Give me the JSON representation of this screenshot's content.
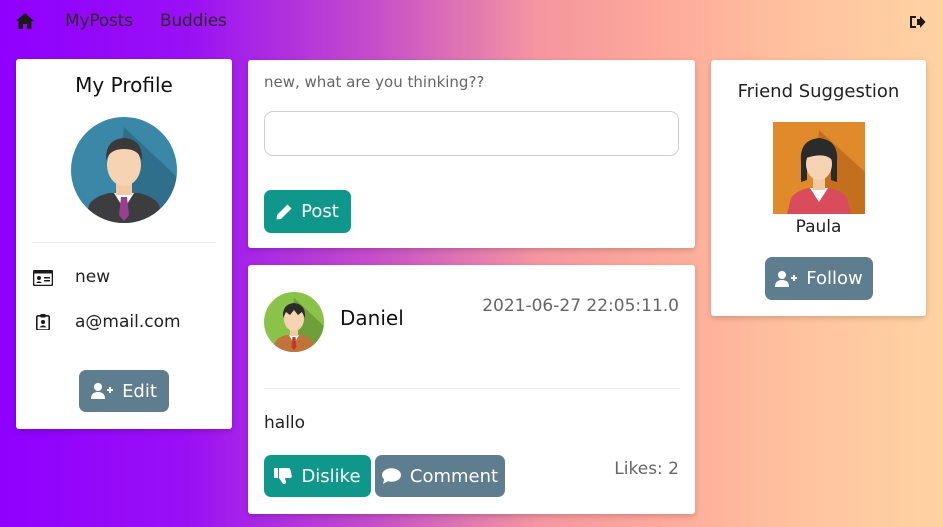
{
  "nav": {
    "home_icon": "home-icon",
    "links": [
      "MyPosts",
      "Buddies"
    ],
    "logout_icon": "sign-out-icon"
  },
  "profile": {
    "title": "My Profile",
    "avatar_icon": "male-user-avatar",
    "username": "new",
    "email": "a@mail.com",
    "edit_label": "Edit"
  },
  "composer": {
    "prompt": "new, what are you thinking??",
    "input_value": "",
    "post_label": "Post"
  },
  "post": {
    "author": "Daniel",
    "timestamp": "2021-06-27 22:05:11.0",
    "content": "hallo",
    "dislike_label": "Dislike",
    "comment_label": "Comment",
    "likes_text": "Likes: 2"
  },
  "suggestion": {
    "title": "Friend Suggestion",
    "name": "Paula",
    "follow_label": "Follow"
  },
  "colors": {
    "teal_button": "#0e978a",
    "grey_button": "#5e7d8e",
    "gradient_start": "#8f00ff",
    "gradient_end": "#ffd2a2"
  }
}
